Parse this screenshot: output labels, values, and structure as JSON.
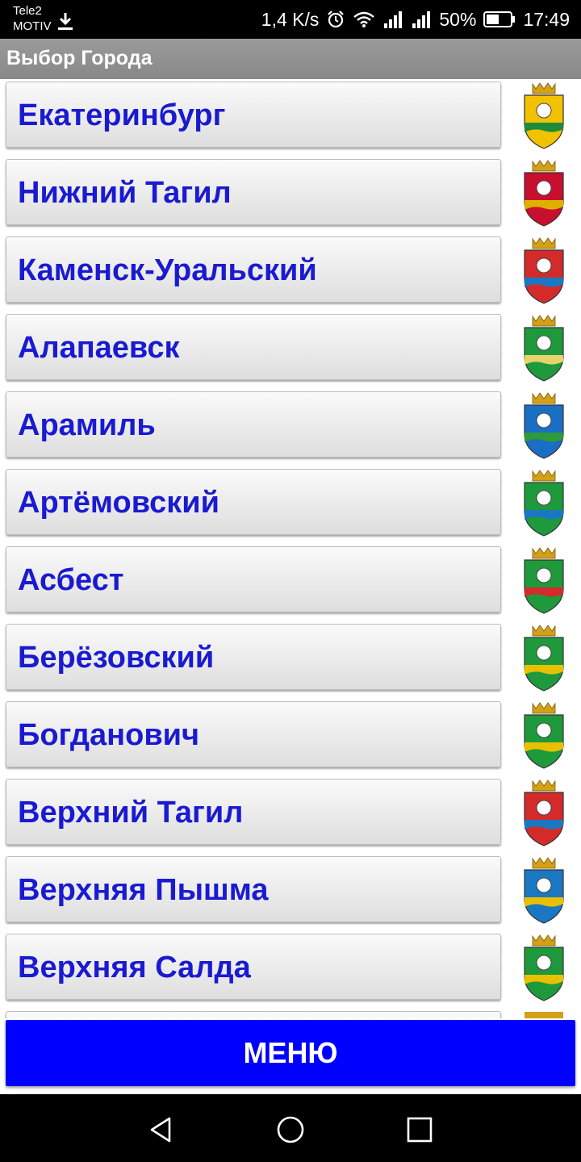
{
  "status_bar": {
    "carrier_line1": "Tele2",
    "carrier_line2": "MOTIV",
    "speed": "1,4 K/s",
    "battery": "50%",
    "time": "17:49"
  },
  "title": "Выбор Города",
  "cities": [
    {
      "name": "Екатеринбург",
      "crest": "yekaterinburg-crest",
      "primary": "#f2c200",
      "secondary": "#1e8a3c"
    },
    {
      "name": "Нижний Тагил",
      "crest": "nizhny-tagil-crest",
      "primary": "#c8102e",
      "secondary": "#e0b000"
    },
    {
      "name": "Каменск-Уральский",
      "crest": "kamensk-uralsky-crest",
      "primary": "#d42a2a",
      "secondary": "#1a78c2"
    },
    {
      "name": "Алапаевск",
      "crest": "alapaevsk-crest",
      "primary": "#1e9a3c",
      "secondary": "#e8d36a"
    },
    {
      "name": "Арамиль",
      "crest": "aramil-crest",
      "primary": "#1a6fc4",
      "secondary": "#2e9a3c"
    },
    {
      "name": "Артёмовский",
      "crest": "artyomovsky-crest",
      "primary": "#1e9a3c",
      "secondary": "#1a78c2"
    },
    {
      "name": "Асбест",
      "crest": "asbest-crest",
      "primary": "#1e9a3c",
      "secondary": "#d42a2a"
    },
    {
      "name": "Берёзовский",
      "crest": "beryozovsky-crest",
      "primary": "#1e9a3c",
      "secondary": "#e8c000"
    },
    {
      "name": "Богданович",
      "crest": "bogdanovich-crest",
      "primary": "#1e9a3c",
      "secondary": "#e8c000"
    },
    {
      "name": "Верхний Тагил",
      "crest": "verkhny-tagil-crest",
      "primary": "#d42a2a",
      "secondary": "#1a78c2"
    },
    {
      "name": "Верхняя Пышма",
      "crest": "verkhnyaya-pyshma-crest",
      "primary": "#1a78c2",
      "secondary": "#e8c000"
    },
    {
      "name": "Верхняя Салда",
      "crest": "verkhnyaya-salda-crest",
      "primary": "#1e9a3c",
      "secondary": "#e8c000"
    }
  ],
  "menu_button": "МЕНЮ",
  "colors": {
    "city_text": "#1a1ad0",
    "menu_bg": "#0000ff",
    "title_bar": "#909090"
  }
}
